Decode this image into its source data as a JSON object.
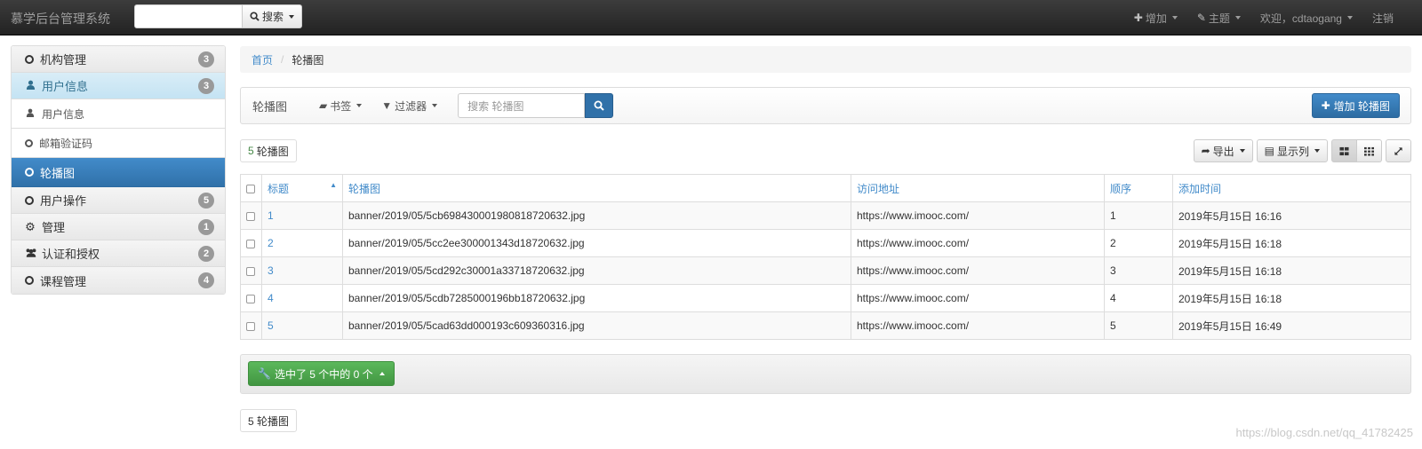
{
  "navbar": {
    "brand": "慕学后台管理系统",
    "search_button": "搜索",
    "add": "增加",
    "theme": "主题",
    "welcome": "欢迎，cdtaogang",
    "logout": "注销"
  },
  "sidebar": {
    "groups": [
      {
        "label": "机构管理",
        "count": "3"
      },
      {
        "label": "用户信息",
        "count": "3"
      },
      {
        "label": "用户操作",
        "count": "5"
      },
      {
        "label": "管理",
        "count": "1"
      },
      {
        "label": "认证和授权",
        "count": "2"
      },
      {
        "label": "课程管理",
        "count": "4"
      }
    ],
    "sub_items": [
      "用户信息",
      "邮箱验证码",
      "轮播图"
    ]
  },
  "breadcrumb": {
    "home": "首页",
    "current": "轮播图"
  },
  "toolbar": {
    "title": "轮播图",
    "bookmarks": "书签",
    "filters": "过滤器",
    "search_placeholder": "搜索 轮播图",
    "add_button": "增加 轮播图"
  },
  "count_top": {
    "n": "5",
    "label": "轮播图"
  },
  "count_bottom": "5 轮播图",
  "buttons": {
    "export": "导出",
    "columns": "显示列"
  },
  "table": {
    "headers": [
      "标题",
      "轮播图",
      "访问地址",
      "顺序",
      "添加时间"
    ],
    "rows": [
      [
        "1",
        "banner/2019/05/5cb698430001980818720632.jpg",
        "https://www.imooc.com/",
        "1",
        "2019年5月15日 16:16"
      ],
      [
        "2",
        "banner/2019/05/5cc2ee300001343d18720632.jpg",
        "https://www.imooc.com/",
        "2",
        "2019年5月15日 16:18"
      ],
      [
        "3",
        "banner/2019/05/5cd292c30001a33718720632.jpg",
        "https://www.imooc.com/",
        "3",
        "2019年5月15日 16:18"
      ],
      [
        "4",
        "banner/2019/05/5cdb7285000196bb18720632.jpg",
        "https://www.imooc.com/",
        "4",
        "2019年5月15日 16:18"
      ],
      [
        "5",
        "banner/2019/05/5cad63dd000193c609360316.jpg",
        "https://www.imooc.com/",
        "5",
        "2019年5月15日 16:49"
      ]
    ]
  },
  "action": "选中了 5 个中的 0 个",
  "watermark": "https://blog.csdn.net/qq_41782425",
  "colors": {
    "primary": "#428bca",
    "success": "#5cb85c",
    "navbar": "#222222"
  }
}
